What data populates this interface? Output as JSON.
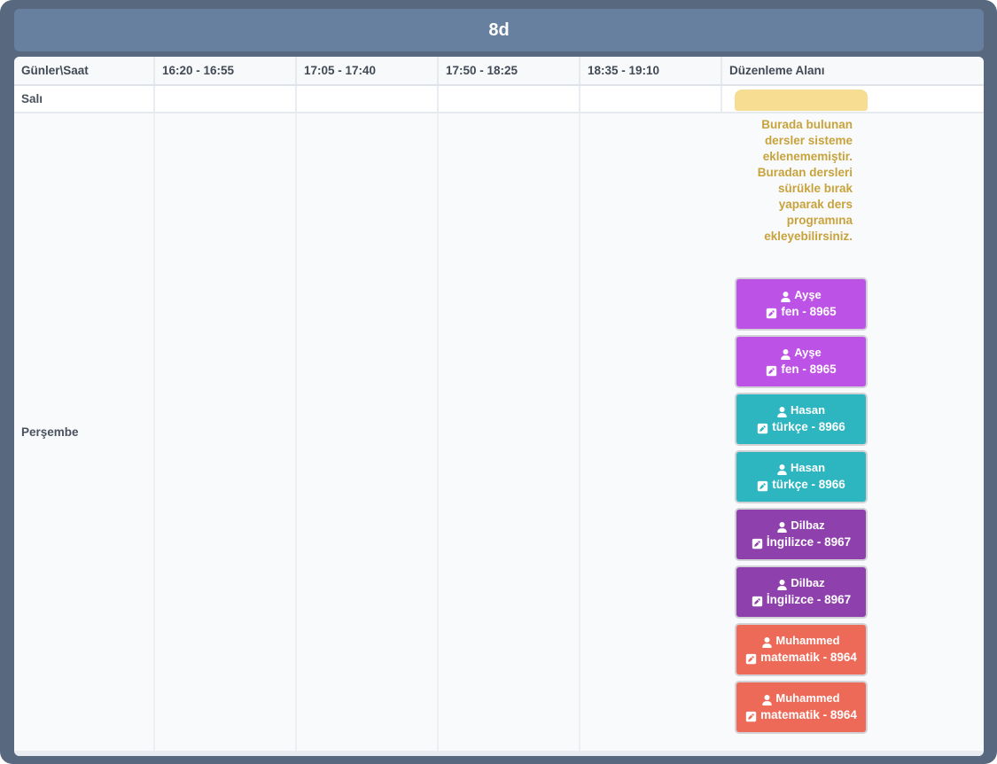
{
  "title": "8d",
  "table": {
    "columns": [
      "Günler\\Saat",
      "16:20 - 16:55",
      "17:05 - 17:40",
      "17:50 - 18:25",
      "18:35 - 19:10",
      "Düzenleme Alanı"
    ],
    "rows": [
      {
        "label": "Salı"
      },
      {
        "label": "Perşembe"
      }
    ]
  },
  "editing_area": {
    "note": "Burada bulunan dersler sisteme eklenememiştir. Buradan dersleri sürükle bırak yaparak ders programına ekleyebilirsiniz.",
    "cards": [
      {
        "teacher": "Ayşe",
        "subject": "fen - 8965",
        "color": "#bc53e6"
      },
      {
        "teacher": "Ayşe",
        "subject": "fen - 8965",
        "color": "#bc53e6"
      },
      {
        "teacher": "Hasan",
        "subject": "türkçe - 8966",
        "color": "#2db5c0"
      },
      {
        "teacher": "Hasan",
        "subject": "türkçe - 8966",
        "color": "#2db5c0"
      },
      {
        "teacher": "Dilbaz",
        "subject": "İngilizce - 8967",
        "color": "#8e41ac"
      },
      {
        "teacher": "Dilbaz",
        "subject": "İngilizce - 8967",
        "color": "#8e41ac"
      },
      {
        "teacher": "Muhammed",
        "subject": "matematik - 8964",
        "color": "#ee6a58"
      },
      {
        "teacher": "Muhammed",
        "subject": "matematik - 8964",
        "color": "#ee6a58"
      }
    ],
    "icons": {
      "teacher_icon": "user-icon",
      "subject_icon": "edit-icon"
    }
  },
  "colors": {
    "frame_bg": "#57687f",
    "titlebar_bg": "#68809f",
    "note_bg": "#f6dd92",
    "note_text": "#c8a33c",
    "table_header_bg": "#f7f9fb",
    "tall_row_bg": "#f8fafc",
    "footer_strip": "#e9edf2"
  }
}
